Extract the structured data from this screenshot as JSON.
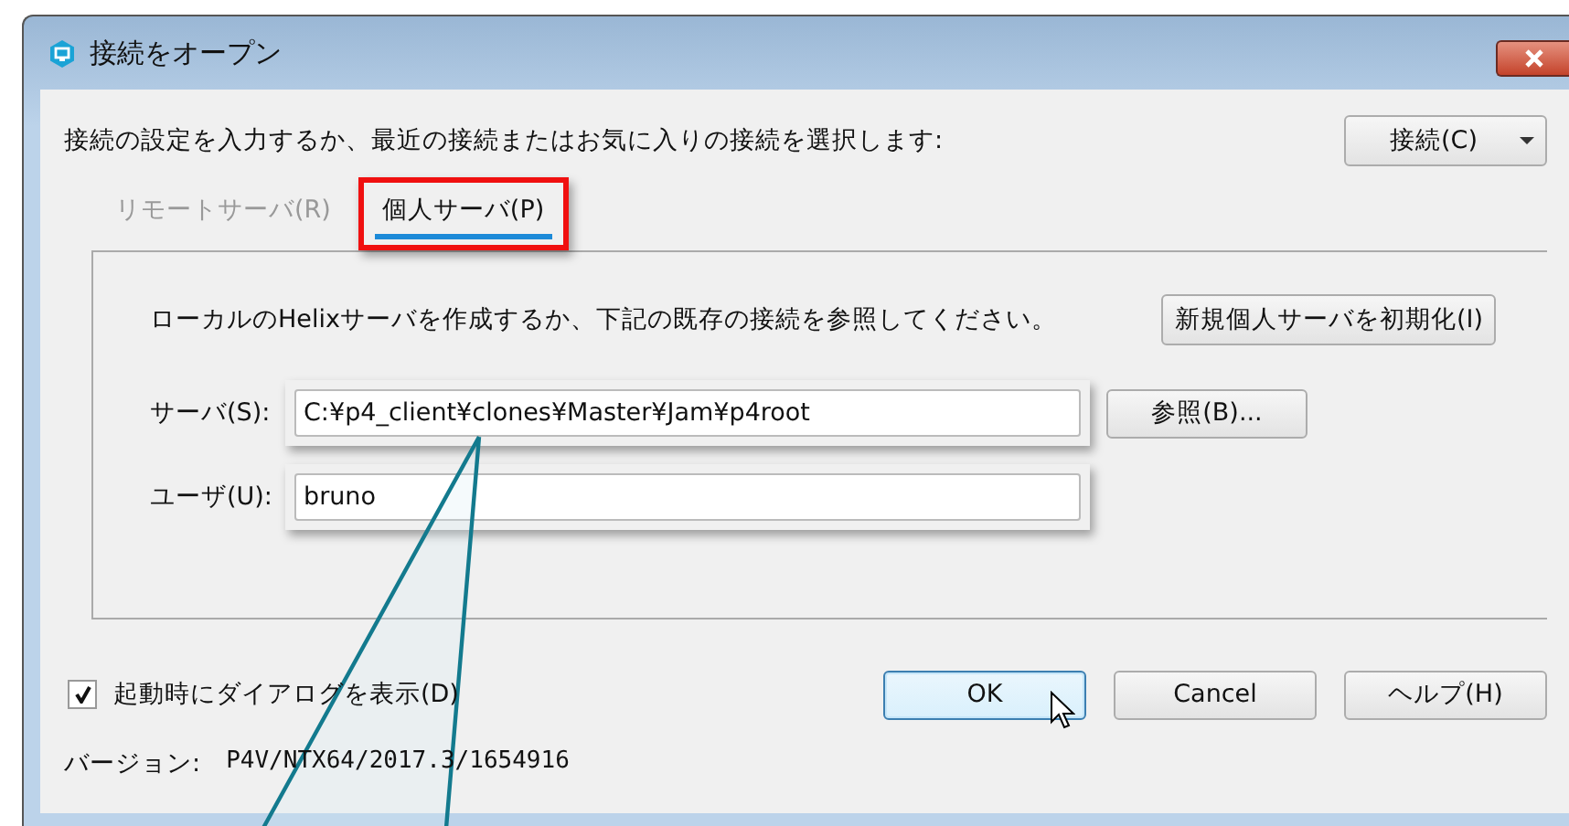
{
  "window": {
    "title": "接続をオープン"
  },
  "instruction": "接続の設定を入力するか、最近の接続またはお気に入りの接続を選択します:",
  "connection_menu": {
    "label": "接続(C)"
  },
  "tabs": [
    {
      "label": "リモートサーバ(R)",
      "selected": false,
      "highlighted": false
    },
    {
      "label": "個人サーバ(P)",
      "selected": true,
      "highlighted": true
    }
  ],
  "panel": {
    "description": "ローカルのHelixサーバを作成するか、下記の既存の接続を参照してください。",
    "init_button": "新規個人サーバを初期化(I)",
    "fields": [
      {
        "label": "サーバ(S):",
        "value": "C:¥p4_client¥clones¥Master¥Jam¥p4root",
        "highlighted": true,
        "button": "参照(B)..."
      },
      {
        "label": "ユーザ(U):",
        "value": "bruno",
        "highlighted": true
      }
    ]
  },
  "show_at_startup": {
    "label": "起動時にダイアログを表示(D)",
    "checked": true
  },
  "buttons": [
    {
      "label": "OK",
      "default": true
    },
    {
      "label": "Cancel",
      "default": false
    },
    {
      "label": "ヘルプ(H)",
      "default": false
    }
  ],
  "version": {
    "label": "バージョン:",
    "value": "P4V/NTX64/2017.3/1654916"
  }
}
